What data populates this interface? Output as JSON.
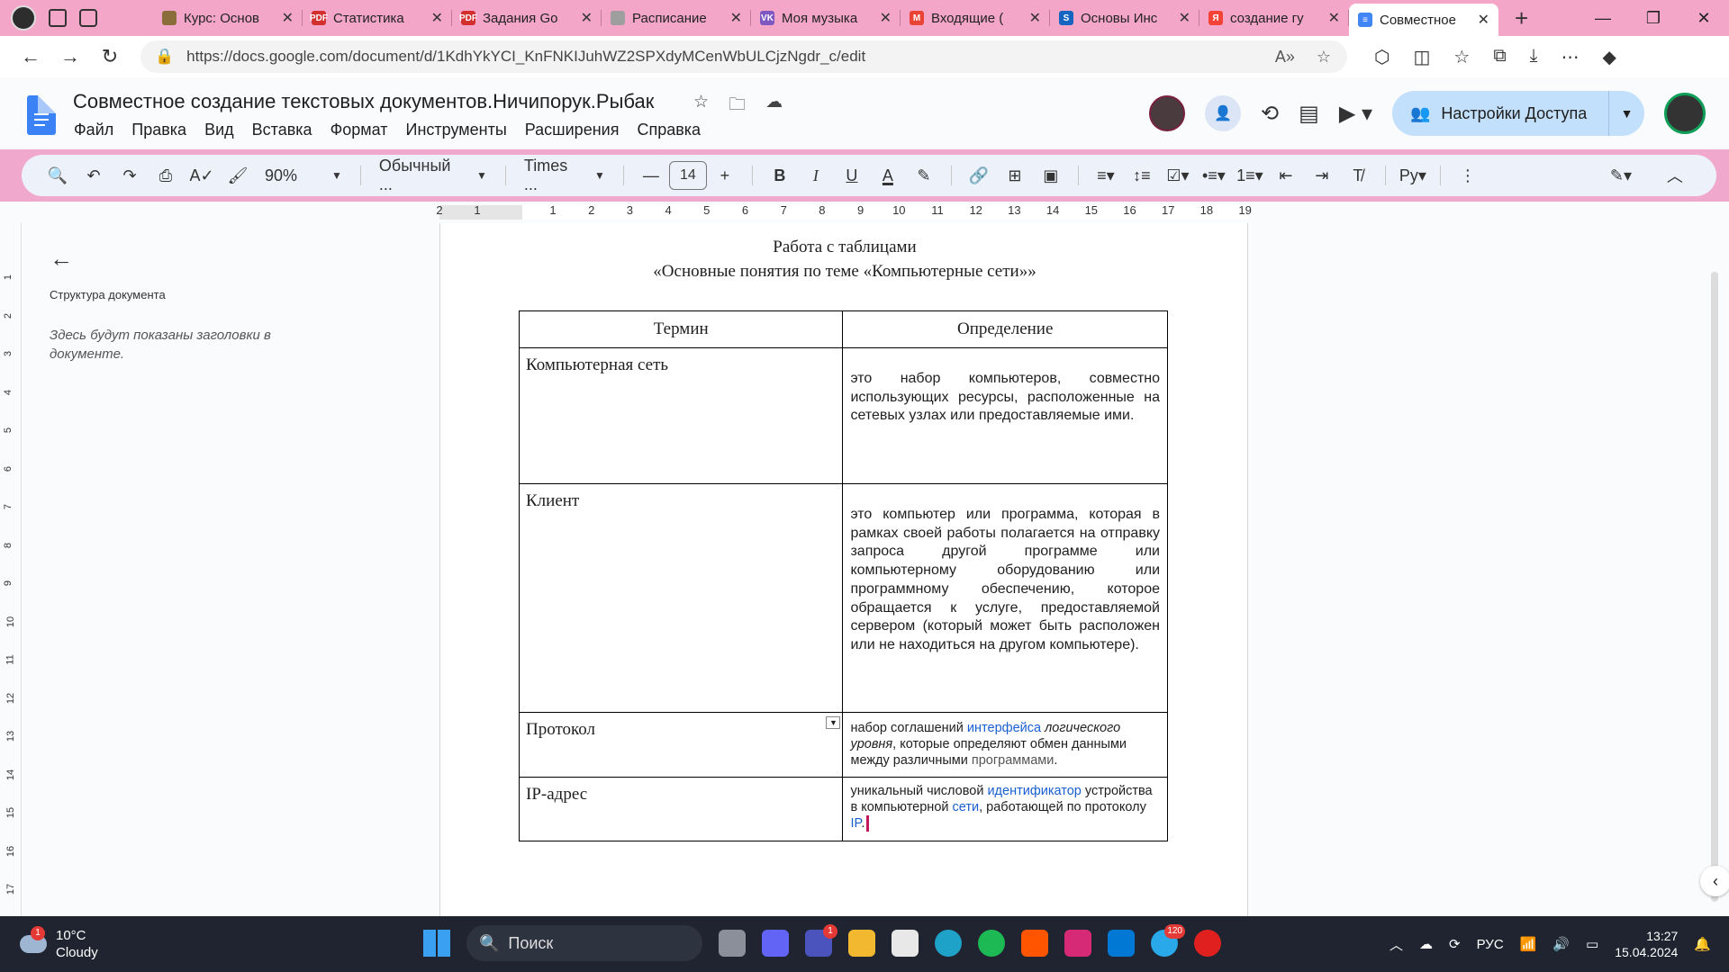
{
  "browser": {
    "tabs": [
      {
        "title": "Курс: Основ",
        "color": "#8a6d3b",
        "glyph": ""
      },
      {
        "title": "Статистика",
        "color": "#d32f2f",
        "glyph": "PDF"
      },
      {
        "title": "Задания Go",
        "color": "#d32f2f",
        "glyph": "PDF"
      },
      {
        "title": "Расписание",
        "color": "#9e9e9e",
        "glyph": ""
      },
      {
        "title": "Моя музыка",
        "color": "#7e57c2",
        "glyph": "VK"
      },
      {
        "title": "Входящие (",
        "color": "#ea4335",
        "glyph": "M"
      },
      {
        "title": "Основы Инс",
        "color": "#1565c0",
        "glyph": "S"
      },
      {
        "title": "создание гу",
        "color": "#f44336",
        "glyph": "Я"
      },
      {
        "title": "Совместное",
        "color": "#4285f4",
        "glyph": "≡"
      }
    ],
    "url": "https://docs.google.com/document/d/1KdhYkYCI_KnFNKIJuhWZ2SPXdyMCenWbULCjzNgdr_c/edit"
  },
  "docs": {
    "title": "Совместное создание текстовых документов.Ничипорук.Рыбак",
    "menu": [
      "Файл",
      "Правка",
      "Вид",
      "Вставка",
      "Формат",
      "Инструменты",
      "Расширения",
      "Справка"
    ],
    "share_label": "Настройки Доступа",
    "toolbar": {
      "zoom": "90%",
      "style": "Обычный ...",
      "font": "Times ...",
      "font_size": "14"
    },
    "ruler_numbers": [
      "2",
      "1",
      "1",
      "2",
      "3",
      "4",
      "5",
      "6",
      "7",
      "8",
      "9",
      "10",
      "11",
      "12",
      "13",
      "14",
      "15",
      "16",
      "17",
      "18",
      "19"
    ],
    "vruler_numbers": [
      "1",
      "2",
      "3",
      "4",
      "5",
      "6",
      "7",
      "8",
      "9",
      "10",
      "11",
      "12",
      "13",
      "14",
      "15",
      "16",
      "17"
    ]
  },
  "outline": {
    "title": "Структура документа",
    "hint": "Здесь будут показаны заголовки в документе."
  },
  "document": {
    "heading1": "Работа с таблицами",
    "heading2": "«Основные понятия по теме «Компьютерные сети»»",
    "table": {
      "headers": [
        "Термин",
        "Определение"
      ],
      "rows": [
        {
          "term": "Компьютерная сеть",
          "definition": "это набор компьютеров, совместно использующих ресурсы, расположенные на сетевых узлах или предоставляемые ими."
        },
        {
          "term": "Клиент",
          "definition": "это компьютер или программа, которая в рамках своей работы полагается на отправку запроса другой программе или компьютерному оборудованию или программному обеспечению, которое обращается к услуге, предоставляемой сервером (который может быть расположен или не находиться на другом компьютере)."
        },
        {
          "term": "Протокол",
          "def_parts": [
            "набор соглашений ",
            "интерфейса",
            " логического уровня",
            ", которые определяют обмен данными между различными ",
            "программами",
            "."
          ]
        },
        {
          "term": "IP-адрес",
          "def_parts": [
            "уникальный числовой ",
            "идентификатор",
            " устройства в компьютерной ",
            "сети",
            ", работающей по протоколу ",
            "IP",
            "."
          ]
        }
      ]
    }
  },
  "taskbar": {
    "temperature": "10°C",
    "weather": "Cloudy",
    "weather_badge": "1",
    "search": "Поиск",
    "teams_badge": "1",
    "telegram_badge": "120",
    "lang": "РУС",
    "time": "13:27",
    "date": "15.04.2024"
  }
}
